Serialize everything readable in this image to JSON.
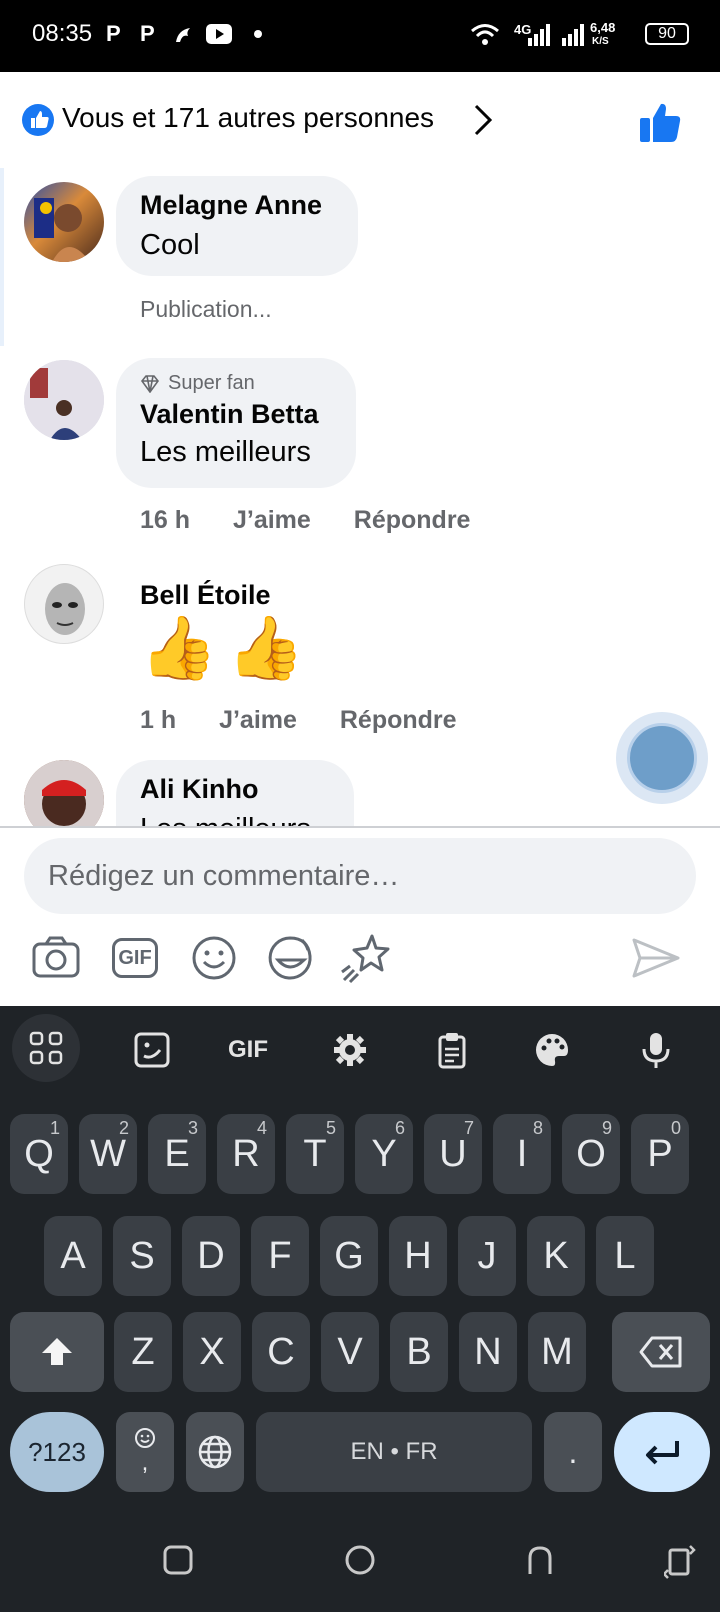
{
  "status_bar": {
    "time": "08:35",
    "apps": [
      "P",
      "P"
    ],
    "network": "4G",
    "speed_top": "6,48",
    "speed_unit": "K/S",
    "battery": "90"
  },
  "likes_header": {
    "text": "Vous et 171 autres personnes"
  },
  "comments": [
    {
      "name": "Melagne Anne",
      "text": "Cool",
      "footer": "Publication..."
    },
    {
      "badge": "Super fan",
      "name": "Valentin Betta",
      "text": "Les meilleurs",
      "time": "16 h",
      "like": "J’aime",
      "reply": "Répondre"
    },
    {
      "name": "Bell Étoile",
      "text": "👍👍",
      "time": "1 h",
      "like": "J’aime",
      "reply": "Répondre"
    },
    {
      "name": "Ali Kinho",
      "text": "Les meilleurs"
    }
  ],
  "composer": {
    "placeholder": "Rédigez un commentaire…",
    "gif_label": "GIF"
  },
  "keyboard": {
    "toolbar_gif": "GIF",
    "row1": [
      {
        "k": "Q",
        "n": "1"
      },
      {
        "k": "W",
        "n": "2"
      },
      {
        "k": "E",
        "n": "3"
      },
      {
        "k": "R",
        "n": "4"
      },
      {
        "k": "T",
        "n": "5"
      },
      {
        "k": "Y",
        "n": "6"
      },
      {
        "k": "U",
        "n": "7"
      },
      {
        "k": "I",
        "n": "8"
      },
      {
        "k": "O",
        "n": "9"
      },
      {
        "k": "P",
        "n": "0"
      }
    ],
    "row2": [
      "A",
      "S",
      "D",
      "F",
      "G",
      "H",
      "J",
      "K",
      "L"
    ],
    "row3": [
      "Z",
      "X",
      "C",
      "V",
      "B",
      "N",
      "M"
    ],
    "symbols": "?123",
    "comma": ",",
    "space": "EN • FR",
    "period": "."
  }
}
